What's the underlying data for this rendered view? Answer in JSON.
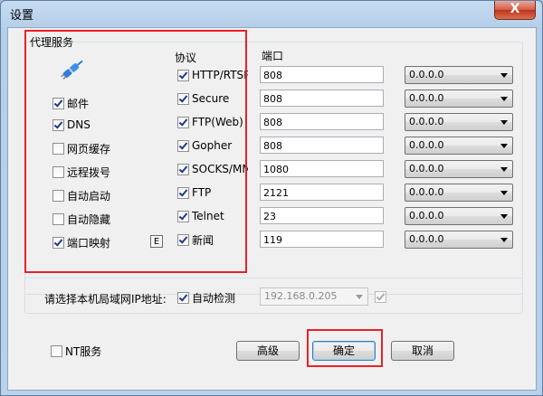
{
  "window": {
    "title": "设置",
    "close_glyph": "X"
  },
  "proxy": {
    "label": "代理服务",
    "icon": "network-plug-icon",
    "services": [
      {
        "name": "mail",
        "label": "邮件",
        "checked": true
      },
      {
        "name": "dns",
        "label": "DNS",
        "checked": true
      },
      {
        "name": "web-cache",
        "label": "网页缓存",
        "checked": false
      },
      {
        "name": "remote-dial",
        "label": "远程拨号",
        "checked": false
      },
      {
        "name": "auto-start",
        "label": "自动启动",
        "checked": false
      },
      {
        "name": "auto-hide",
        "label": "自动隐藏",
        "checked": false
      },
      {
        "name": "port-mapping",
        "label": "端口映射",
        "checked": true
      }
    ],
    "e_button": "E"
  },
  "protocols": {
    "header": "协议",
    "port_header": "端口",
    "items": [
      {
        "label": "HTTP/RTSP",
        "checked": true,
        "port": "808",
        "ip": "0.0.0.0"
      },
      {
        "label": "Secure",
        "checked": true,
        "port": "808",
        "ip": "0.0.0.0"
      },
      {
        "label": "FTP(Web)",
        "checked": true,
        "port": "808",
        "ip": "0.0.0.0"
      },
      {
        "label": "Gopher",
        "checked": true,
        "port": "808",
        "ip": "0.0.0.0"
      },
      {
        "label": "SOCKS/MMS",
        "checked": true,
        "port": "1080",
        "ip": "0.0.0.0"
      },
      {
        "label": "FTP",
        "checked": true,
        "port": "2121",
        "ip": "0.0.0.0"
      },
      {
        "label": "Telnet",
        "checked": true,
        "port": "23",
        "ip": "0.0.0.0"
      },
      {
        "label": "新闻",
        "checked": true,
        "port": "119",
        "ip": "0.0.0.0"
      }
    ]
  },
  "lan": {
    "label": "请选择本机局域网IP地址:",
    "auto_detect_label": "自动检测",
    "auto_detect_checked": true,
    "ip_value": "192.168.0.205",
    "confirm_checked": true
  },
  "footer": {
    "nt_service_label": "NT服务",
    "nt_service_checked": false,
    "advanced_label": "高级",
    "ok_label": "确定",
    "cancel_label": "取消"
  },
  "colors": {
    "highlight": "#e8212a",
    "title_bar": "#b9d1ea",
    "dialog_bg": "#f0f0f0"
  }
}
